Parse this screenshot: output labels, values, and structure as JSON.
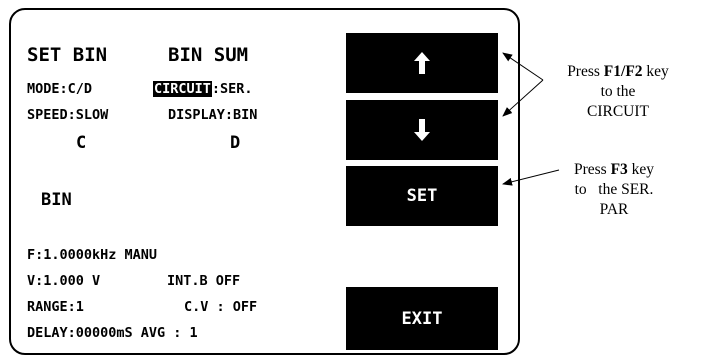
{
  "screen": {
    "title_left": "SET BIN",
    "title_right": "BIN SUM",
    "mode": "MODE:C/D",
    "circuit_key": "CIRCUIT",
    "circuit_value": ":SER.",
    "speed": "SPEED:SLOW",
    "display": "DISPLAY:BIN",
    "col_c": "C",
    "col_d": "D",
    "bin_label": "BIN",
    "freq": "F:1.0000kHz MANU",
    "volt": "V:1.000 V",
    "intb": "INT.B OFF",
    "range": "RANGE:1",
    "cv": "C.V : OFF",
    "delay_avg": "DELAY:00000mS AVG : 1"
  },
  "softkeys": {
    "up_icon": "arrow-up-icon",
    "down_icon": "arrow-down-icon",
    "set_label": "SET",
    "exit_label": "EXIT"
  },
  "annotations": {
    "f1f2": {
      "line1_prefix": "Press ",
      "line1_key": "F1/F2",
      "line1_suffix": " key",
      "line2": "to the",
      "line3": "CIRCUIT"
    },
    "f3": {
      "line1_prefix": "Press ",
      "line1_key": "F3",
      "line1_suffix": "  key",
      "line2": "to   the SER.",
      "line3": "PAR"
    }
  }
}
